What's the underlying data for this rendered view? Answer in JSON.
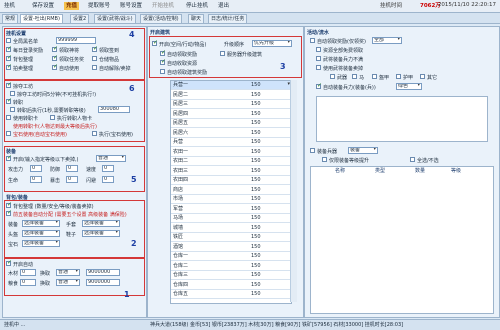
{
  "menubar": {
    "items": [
      "挂机",
      "保存设置",
      "充值",
      "提取账号",
      "账号设置",
      "开始挂机",
      "停止挂机",
      "退出"
    ],
    "active_index": 2,
    "title_prefix": "挂机时间",
    "gold_label": "7062万",
    "title_info": "2015/11/10 22:20:17"
  },
  "tabs": [
    "常规",
    "设置-吐出(RMB)",
    "设置2",
    "设置(武将/战斗)",
    "设置(活动/控制)",
    "聊天",
    "日志/统计/任务"
  ],
  "panel_left_top": {
    "title": "挂机设置",
    "rows": [
      {
        "label": "全局黑名单",
        "value": "999999"
      },
      {
        "label": "自动开战",
        "value": ""
      }
    ],
    "checks": [
      [
        "每日登录奖励",
        "领取神将",
        "领取签到"
      ],
      [
        "背包整理",
        "领取任务奖",
        "仓储物品"
      ],
      [
        "拍卖整理",
        "自动使用",
        "自动解除/卖掉"
      ]
    ]
  },
  "panel_left_mid": {
    "checks": [
      "掠夺工坊",
      "掠夺工坊时间5分钟(不可挂机执行!)",
      "转职",
      "转职后执行(1秒,需要转职等级)"
    ],
    "input_value": "300080",
    "extra_checks": [
      "使用转职卡",
      "执行转职人物卡"
    ],
    "red_lines": [
      "使用转职卡(人物达到最大等级后执行)",
      "宝石使用(自动宝石使用)"
    ],
    "warn_check": "执行(宝石使用)"
  },
  "panel_left_equip": {
    "title": "装备",
    "hint": "开启(输入指定等级以下卖掉,)",
    "select_value": "普通",
    "rows": [
      [
        "攻击力",
        "0",
        "防御",
        "0",
        "速度",
        "0"
      ],
      [
        "生命",
        "0",
        "暴击",
        "0",
        "闪避",
        "0"
      ]
    ]
  },
  "panel_left_bag": {
    "title": "背包/装备",
    "line1": "背包整理 (数量/安全/等级/装备卖掉)",
    "line2": "前五装备自动分配 (需要五个设置 高级装备 满保险)",
    "selects": [
      "选择装备",
      "选择装备",
      "选择装备",
      "选择装备",
      "选择装备"
    ],
    "row_labels": [
      "装备",
      "头盔",
      "武器",
      "护甲",
      "宝石"
    ],
    "right_labels": [
      "手套",
      "鞋子",
      "项链"
    ]
  },
  "panel_left_bottom": {
    "title": "开启自动",
    "rows": [
      {
        "label": "木材",
        "value1": "0",
        "op": "换取",
        "sel": "普通",
        "value2": "9000000"
      },
      {
        "label": "粮食",
        "value1": "0",
        "op": "换取",
        "sel": "普通",
        "value2": "9000000"
      }
    ]
  },
  "center": {
    "title": "开启建筑",
    "opt1": "开启(空间/行动/物品)",
    "opt2": "升级顺序",
    "select": "优先升级",
    "checks": [
      "自动领取奖励",
      "自动收取资源",
      "自动领取建筑奖励"
    ],
    "extra": "服务器升级建筑",
    "table": {
      "rows": [
        [
          "兵营一",
          "150"
        ],
        [
          "民居二",
          "150"
        ],
        [
          "民居三",
          "150"
        ],
        [
          "民居四",
          "150"
        ],
        [
          "民居五",
          "150"
        ],
        [
          "民居六",
          "150"
        ],
        [
          "兵营",
          "150"
        ],
        [
          "农田一",
          "150"
        ],
        [
          "农田二",
          "150"
        ],
        [
          "农田三",
          "150"
        ],
        [
          "农田四",
          "150"
        ],
        [
          "商店",
          "150"
        ],
        [
          "市场",
          "150"
        ],
        [
          "军营",
          "150"
        ],
        [
          "马场",
          "150"
        ],
        [
          "城墙",
          "150"
        ],
        [
          "铁匠",
          "150"
        ],
        [
          "酒馆",
          "150"
        ],
        [
          "仓库一",
          "150"
        ],
        [
          "仓库二",
          "150"
        ],
        [
          "仓库三",
          "150"
        ],
        [
          "仓库四",
          "150"
        ],
        [
          "仓库五",
          "150"
        ]
      ]
    }
  },
  "right": {
    "title": "活动/流水",
    "checks_top": [
      "自动领取奖励(仅领奖)",
      "资源全部免费领取",
      "武将装备兵力不满",
      "使用武将装备卖掉"
    ],
    "select1": "全部",
    "subchecks": [
      "武器",
      "马",
      "盔甲",
      "护甲",
      "其它"
    ],
    "sel2": "绿色",
    "label_list": "自动装备兵力(装备(兵))",
    "bottom_label": "装备兵器",
    "bottom_select": "装备",
    "bottom_check": "仅限装备等级提升",
    "bottom_right": "全选/不选",
    "table_headers": [
      "名称",
      "类型",
      "数量",
      "等级"
    ]
  },
  "statusbar": {
    "text": "挂机中 ...",
    "info": "神兵大道(158级) 金币[53] 银币[23837万] 木材[30万] 粮食[90万] 铁矿[57956] 石材[33000] 挂机时长[28:03]"
  },
  "markers": [
    "1",
    "2",
    "3",
    "4",
    "5",
    "6"
  ]
}
